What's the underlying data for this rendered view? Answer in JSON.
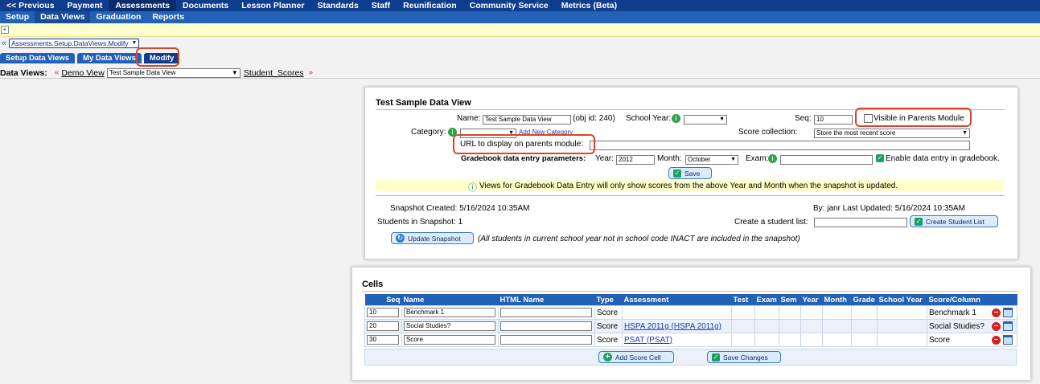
{
  "top_nav": [
    "<< Previous",
    "Payment",
    "Assessments",
    "Documents",
    "Lesson Planner",
    "Standards",
    "Staff",
    "Reunification",
    "Community Service",
    "Metrics (Beta)"
  ],
  "sub_nav": [
    "Setup",
    "Data Views",
    "Graduation",
    "Reports"
  ],
  "breadcrumb": "Assessments.Setup.DataViews.Modify",
  "tabs": [
    "Setup Data Views",
    "My Data Views",
    "Modify"
  ],
  "dataviews": {
    "label": "Data Views:",
    "prev_link": "Demo View",
    "selected": "Test Sample Data View",
    "next_link": "Student_Scores"
  },
  "form": {
    "title": "Test Sample Data View",
    "name_label": "Name:",
    "name_value": "Test Sample Data View",
    "obj_id": "(obj id: 240)",
    "school_year_label": "School Year:",
    "school_year_value": "",
    "seq_label": "Seq:",
    "seq_value": "10",
    "visible_label": "Visible in Parents Module",
    "category_label": "Category:",
    "category_value": "",
    "add_category": "Add New Category",
    "score_collection_label": "Score collection:",
    "score_collection_value": "Store the most recent score",
    "url_label": "URL to display on parents module:",
    "url_value": "",
    "gradebook_label": "Gradebook data entry parameters:",
    "year_label": "Year:",
    "year_value": "2012",
    "month_label": "Month:",
    "month_value": "October",
    "exam_label": "Exam:",
    "exam_value": "",
    "enable_label": "Enable data entry in gradebook.",
    "save_label": "Save",
    "info_text": "Views for Gradebook Data Entry will only show scores from the above Year and Month when the snapshot is updated.",
    "snapshot_created": "Snapshot Created: 5/16/2024 10:35AM",
    "last_updated": "By: janr Last Updated: 5/16/2024 10:35AM",
    "students_in_snapshot": "Students in Snapshot: 1",
    "create_list_label": "Create a student list:",
    "create_list_value": "",
    "create_list_button": "Create Student List",
    "update_snapshot_button": "Update Snapshot",
    "snapshot_note": "(All students in current school year not in school code INACT are included in the snapshot)"
  },
  "cells": {
    "title": "Cells",
    "columns": [
      "Seq",
      "Name",
      "HTML Name",
      "Type",
      "Assessment",
      "Test",
      "Exam",
      "Sem",
      "Year",
      "Month",
      "Grade",
      "School Year",
      "Score/Column"
    ],
    "rows": [
      {
        "seq": "10",
        "name": "Benchmark 1",
        "html_name": "",
        "type": "Score",
        "assessment": "",
        "score_column": "Benchmark 1"
      },
      {
        "seq": "20",
        "name": "Social Studies?",
        "html_name": "",
        "type": "Score",
        "assessment": "HSPA 2011g (HSPA 2011g)",
        "score_column": "Social Studies?"
      },
      {
        "seq": "30",
        "name": "Score",
        "html_name": "",
        "type": "Score",
        "assessment": "PSAT (PSAT)",
        "score_column": "Score"
      }
    ],
    "add_button": "Add Score Cell",
    "save_button": "Save Changes"
  },
  "colors": {
    "nav": "#0f3d8e",
    "subnav": "#2262b6",
    "highlight": "#d9442a",
    "info": "#ffffcc"
  }
}
